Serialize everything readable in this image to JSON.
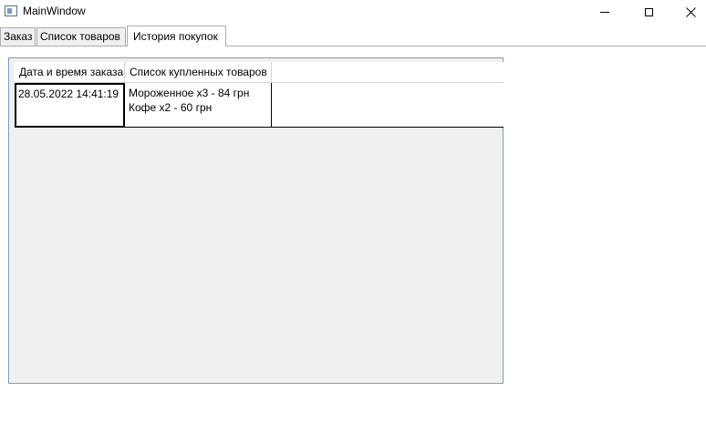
{
  "window": {
    "title": "MainWindow",
    "icons": {
      "app": "window-app-icon",
      "minimize": "minimize-icon",
      "maximize": "maximize-icon",
      "close": "close-icon"
    }
  },
  "tabs": [
    {
      "label": "Заказ",
      "selected": false
    },
    {
      "label": "Список товаров",
      "selected": false
    },
    {
      "label": "История покупок",
      "selected": true
    }
  ],
  "history_grid": {
    "columns": [
      "Дата и время заказа",
      "Список купленных товаров"
    ],
    "rows": [
      {
        "datetime": "28.05.2022 14:41:19",
        "items": [
          "Мороженное x3 - 84 грн",
          "Кофе x2 - 60 грн"
        ]
      }
    ]
  }
}
